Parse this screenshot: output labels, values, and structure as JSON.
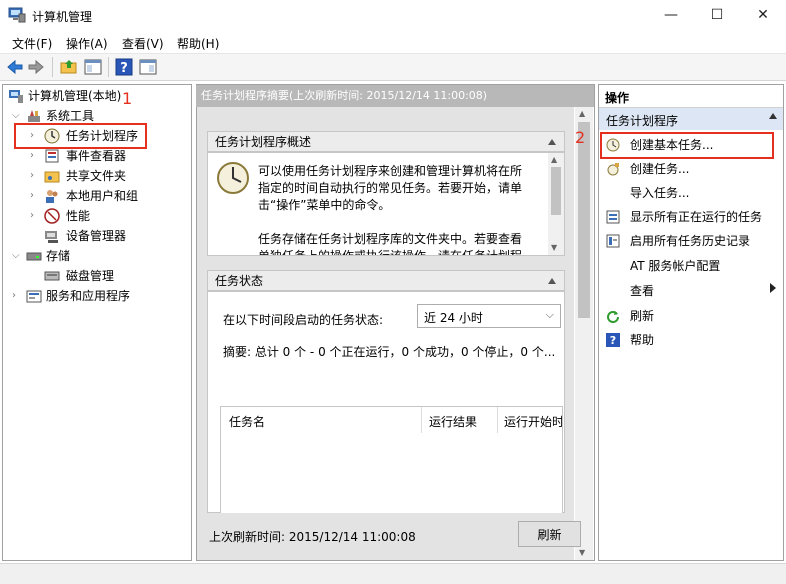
{
  "window": {
    "title": "计算机管理"
  },
  "menu": [
    "文件(F)",
    "操作(A)",
    "查看(V)",
    "帮助(H)"
  ],
  "toolbar": {
    "icons": [
      "back-arrow-icon",
      "forward-arrow-icon",
      "folder-up-icon",
      "show-pane-icon",
      "help-icon",
      "properties-pane-icon"
    ]
  },
  "tree": {
    "root": "计算机管理(本地)",
    "items": [
      {
        "label": "系统工具"
      },
      {
        "label": "任务计划程序"
      },
      {
        "label": "事件查看器"
      },
      {
        "label": "共享文件夹"
      },
      {
        "label": "本地用户和组"
      },
      {
        "label": "性能"
      },
      {
        "label": "设备管理器"
      },
      {
        "label": "存储"
      },
      {
        "label": "磁盘管理"
      },
      {
        "label": "服务和应用程序"
      }
    ]
  },
  "annotations": {
    "one": "1",
    "two": "2"
  },
  "center": {
    "header": "任务计划程序摘要(上次刷新时间: 2015/12/14 11:00:08)",
    "overview": {
      "title": "任务计划程序概述",
      "para1": [
        "可以使用任务计划程序来创建和管理计算机将在所",
        "指定的时间自动执行的常见任务。若要开始，请单",
        "击“操作”菜单中的命令。"
      ],
      "para2": [
        "任务存储在任务计划程序库的文件夹中。若要查看",
        "单独任务上的操作或执行该操作，请在任务计划程"
      ]
    },
    "status": {
      "title": "任务状态",
      "period_label": "在以下时间段启动的任务状态:",
      "period_value": "近 24 小时",
      "summary": "摘要: 总计 0 个 - 0 个正在运行，0 个成功，0 个停止，0 个...",
      "columns": [
        "任务名",
        "运行结果",
        "运行开始时"
      ]
    },
    "footer": {
      "last_refresh": "上次刷新时间: 2015/12/14 11:00:08",
      "refresh_button": "刷新"
    }
  },
  "actions": {
    "header": "操作",
    "section": "任务计划程序",
    "items": [
      {
        "label": "创建基本任务..."
      },
      {
        "label": "创建任务..."
      },
      {
        "label": "导入任务..."
      },
      {
        "label": "显示所有正在运行的任务"
      },
      {
        "label": "启用所有任务历史记录"
      },
      {
        "label": "AT 服务帐户配置"
      },
      {
        "label": "查看"
      },
      {
        "label": "刷新"
      },
      {
        "label": "帮助"
      }
    ]
  },
  "colors": {
    "highlight_red": "#e53020",
    "header_gray": "#b8b8b8",
    "section_blue": "#dce6f4"
  }
}
